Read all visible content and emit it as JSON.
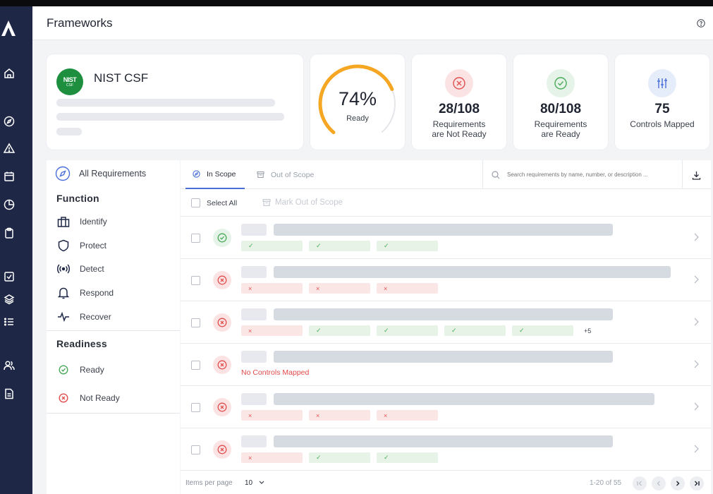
{
  "header": {
    "title": "Frameworks"
  },
  "framework": {
    "badge_top": "NIST",
    "badge_bottom": "CSF",
    "name": "NIST CSF"
  },
  "gauge": {
    "value": "74%",
    "label": "Ready",
    "percent": 74
  },
  "stats": [
    {
      "value": "28/108",
      "label_line1": "Requirements",
      "label_line2": "are Not Ready",
      "icon": "x-circle-icon"
    },
    {
      "value": "80/108",
      "label_line1": "Requirements",
      "label_line2": "are Ready",
      "icon": "check-circle-icon"
    },
    {
      "value": "75",
      "label_line1": "Controls Mapped",
      "label_line2": "",
      "icon": "sliders-icon"
    }
  ],
  "filters": {
    "all_label": "All Requirements",
    "function_heading": "Function",
    "functions": [
      "Identify",
      "Protect",
      "Detect",
      "Respond",
      "Recover"
    ],
    "readiness_heading": "Readiness",
    "readiness": [
      "Ready",
      "Not Ready"
    ]
  },
  "tabs": {
    "in_scope": "In Scope",
    "out_of_scope": "Out of Scope"
  },
  "search": {
    "placeholder": "Search requirements by name, number, or description ..."
  },
  "actions": {
    "select_all": "Select All",
    "mark_out_of_scope": "Mark Out of Scope"
  },
  "rows": [
    {
      "status": "ready",
      "chips": [
        "ok",
        "ok",
        "ok"
      ],
      "more": "",
      "note": ""
    },
    {
      "status": "not_ready",
      "chips": [
        "bad",
        "bad",
        "bad"
      ],
      "more": "",
      "note": ""
    },
    {
      "status": "not_ready",
      "chips": [
        "bad",
        "ok",
        "ok",
        "ok",
        "ok"
      ],
      "more": "+5",
      "note": ""
    },
    {
      "status": "not_ready",
      "chips": [],
      "more": "",
      "note": "No Controls Mapped"
    },
    {
      "status": "not_ready",
      "chips": [
        "bad",
        "bad",
        "bad"
      ],
      "more": "",
      "note": ""
    },
    {
      "status": "not_ready",
      "chips": [
        "bad",
        "ok",
        "ok"
      ],
      "more": "",
      "note": ""
    }
  ],
  "footer": {
    "items_per_page_label": "Items per page",
    "items_per_page": "10",
    "range": "1-20 of 55"
  },
  "colors": {
    "nav_bg": "#1e2745",
    "gauge_orange": "#f5a623",
    "ready_green": "#4bab5a",
    "not_ready_red": "#e05050",
    "accent_blue": "#4a6fd8"
  }
}
